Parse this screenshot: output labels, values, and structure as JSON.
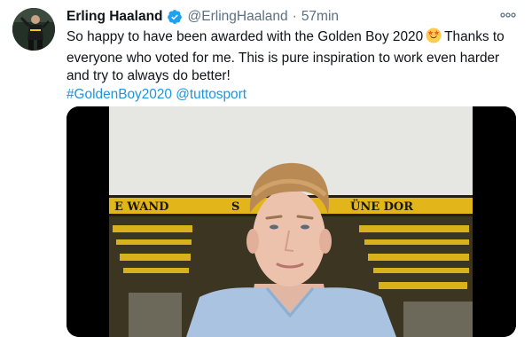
{
  "author": {
    "display_name": "Erling Haaland",
    "handle": "@ErlingHaaland",
    "separator": "·",
    "time": "57min"
  },
  "tweet": {
    "line1_before_emoji": "So happy to have been awarded with the Golden Boy 2020",
    "line1_after_emoji": "Thanks to",
    "line2": "everyone who voted for me. This is pure inspiration to work even harder",
    "line3": "and try to always do better!",
    "hashtag": "#GoldenBoy2020",
    "mention": "@tuttosport",
    "emoji": "star-struck-emoji"
  },
  "media": {
    "banner_left": "E WAND",
    "banner_mid": "S",
    "banner_right": "ÜNE DOR"
  },
  "icons": {
    "verified": "verified-badge-icon",
    "more": "more-options-icon"
  },
  "colors": {
    "link": "#1b95e0",
    "verified": "#1da1f2",
    "secondary_text": "#5b7083",
    "stadium_yellow": "#f3c81c"
  }
}
